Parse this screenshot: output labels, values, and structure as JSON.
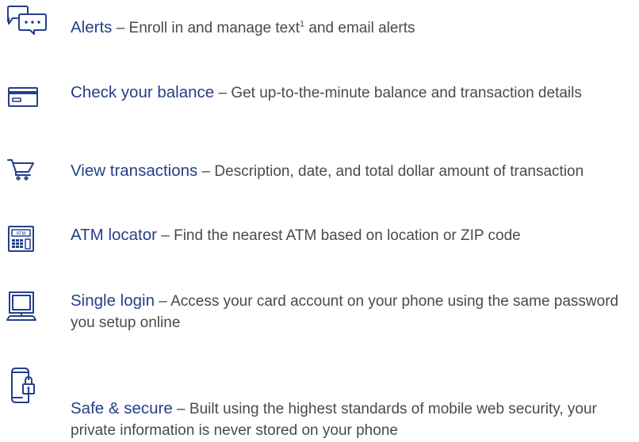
{
  "features": [
    {
      "icon": "chat-bubbles-icon",
      "title": "Alerts",
      "separator": " – ",
      "description": "Enroll in and manage text",
      "footnote": "1",
      "description_after": " and email alerts"
    },
    {
      "icon": "credit-card-icon",
      "title": "Check your balance",
      "separator": " – ",
      "description": "Get up-to-the-minute balance and transaction details"
    },
    {
      "icon": "shopping-cart-icon",
      "title": "View transactions",
      "separator": " – ",
      "description": "Description, date, and total dollar amount of transaction"
    },
    {
      "icon": "atm-icon",
      "atm_label": "ATM",
      "title": "ATM locator",
      "separator": " – ",
      "description": "Find the nearest ATM based on location or ZIP code"
    },
    {
      "icon": "computer-icon",
      "title": "Single login",
      "separator": " – ",
      "description": "Access your card account on your phone using the same password you setup online"
    },
    {
      "icon": "phone-lock-icon",
      "title": "Safe & secure",
      "separator": " – ",
      "description": "Built using the highest standards of mobile web security, your private information is never stored on your phone"
    }
  ],
  "colors": {
    "icon_stroke": "#243f8a",
    "title": "#243f8a",
    "body_text": "#4a4a4a"
  }
}
